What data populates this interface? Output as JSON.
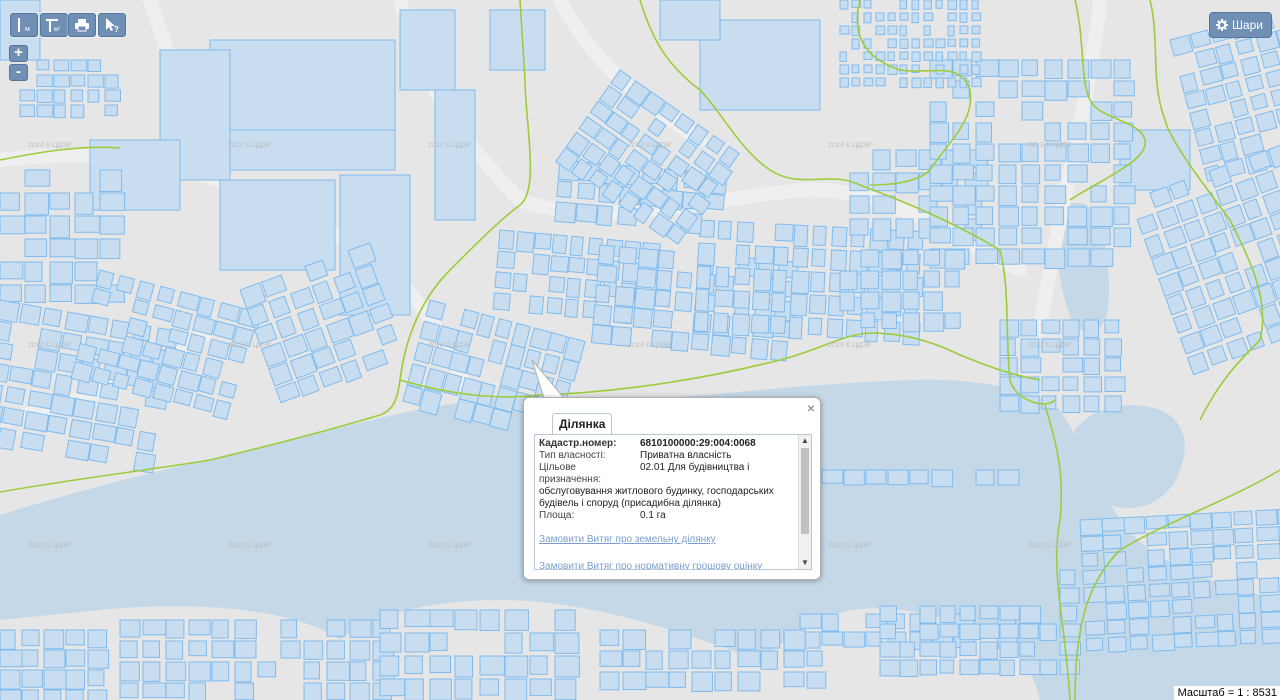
{
  "toolbar": {
    "measure_length_label": "м",
    "measure_area_label": "м²"
  },
  "layers_button": {
    "label": "Шари"
  },
  "zoom": {
    "in": "+",
    "out": "-"
  },
  "watermark": "2013 © ЦДЗК",
  "scale": "Масштаб = 1 : 8531",
  "popup": {
    "tab": "Ділянка",
    "close": "×",
    "fields": [
      {
        "label": "Кадастр.номер:",
        "value": "6810100000:29:004:0068",
        "bold": true
      },
      {
        "label": "Тип власності:",
        "value": "Приватна власність",
        "bold": false
      },
      {
        "label": "Цільове призначення:",
        "value": "02.01 Для будівництва і",
        "bold": false
      }
    ],
    "purpose_continued": "обслуговування житлового будинку, господарських будівель і споруд (присадибна ділянка)",
    "area": {
      "label": "Площа:",
      "value": "0.1 га"
    },
    "links": [
      "Замовити Витяг про земельну ділянку",
      "Замовити Витяг про нормативну грошову оцінку"
    ]
  },
  "colors": {
    "map_bg": "#e6e6e6",
    "water": "#c4d8e8",
    "parcel_fill": "#c8ddf0",
    "parcel_stroke": "#7fbbee",
    "boundary": "#9ccc3a",
    "button": "#6f8fb5"
  }
}
